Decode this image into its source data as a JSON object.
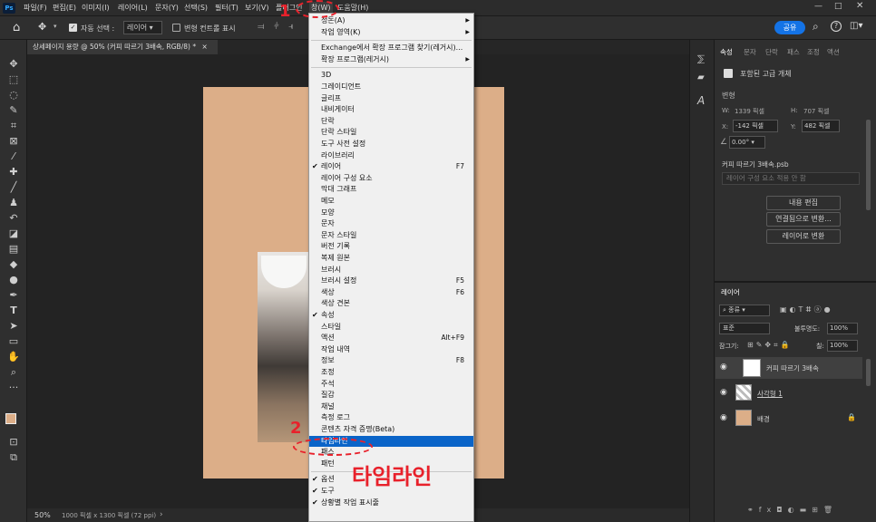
{
  "menubar": {
    "logo": "Ps",
    "items": [
      "파일(F)",
      "편집(E)",
      "이미지(I)",
      "레이어(L)",
      "문자(Y)",
      "선택(S)",
      "필터(T)",
      "보기(V)",
      "플러그인",
      "창(W)",
      "도움말(H)"
    ]
  },
  "options": {
    "auto_select_label": "자동 선택 :",
    "auto_select_value": "레이어",
    "transform_label": "변형 컨트롤 표시",
    "share_label": "공유"
  },
  "doc_tab": {
    "title": "상세페이지 용량 @ 50% (커피 따르기 3배속, RGB/8) *",
    "close": "×"
  },
  "status": {
    "zoom": "50%",
    "info": "1000 픽셀 x 1300 픽셀 (72 ppi)",
    "arrow": "›"
  },
  "window_menu": {
    "items": [
      {
        "label": "정돈(A)",
        "submenu": true
      },
      {
        "label": "작업 영역(K)",
        "submenu": true
      },
      {
        "sep": true
      },
      {
        "label": "Exchange에서 확장 프로그램 찾기(레거시)..."
      },
      {
        "label": "확장 프로그램(레거시)",
        "submenu": true
      },
      {
        "sep": true
      },
      {
        "label": "3D"
      },
      {
        "label": "그레이디언트"
      },
      {
        "label": "글리프"
      },
      {
        "label": "내비게이터"
      },
      {
        "label": "단락"
      },
      {
        "label": "단락 스타일"
      },
      {
        "label": "도구 사전 설정"
      },
      {
        "label": "라이브러리"
      },
      {
        "label": "레이어",
        "check": true,
        "shortcut": "F7"
      },
      {
        "label": "레이어 구성 요소"
      },
      {
        "label": "막대 그래프"
      },
      {
        "label": "메모"
      },
      {
        "label": "모양"
      },
      {
        "label": "문자"
      },
      {
        "label": "문자 스타일"
      },
      {
        "label": "버전 기록"
      },
      {
        "label": "복제 원본"
      },
      {
        "label": "브러시"
      },
      {
        "label": "브러시 설정",
        "shortcut": "F5"
      },
      {
        "label": "색상",
        "shortcut": "F6"
      },
      {
        "label": "색상 견본"
      },
      {
        "label": "속성",
        "check": true
      },
      {
        "label": "스타일"
      },
      {
        "label": "액션",
        "shortcut": "Alt+F9"
      },
      {
        "label": "작업 내역"
      },
      {
        "label": "정보",
        "shortcut": "F8"
      },
      {
        "label": "조정"
      },
      {
        "label": "주석"
      },
      {
        "label": "질감"
      },
      {
        "label": "채널"
      },
      {
        "label": "측정 로그"
      },
      {
        "label": "콘텐츠 자격 증명(Beta)"
      },
      {
        "label": "타임라인",
        "highlight": true
      },
      {
        "label": "패스"
      },
      {
        "label": "패턴"
      },
      {
        "sep": true
      },
      {
        "label": "옵션",
        "check": true
      },
      {
        "label": "도구",
        "check": true
      },
      {
        "label": "상황별 작업 표시줄",
        "check": true
      }
    ]
  },
  "annotations": {
    "step1": "1",
    "step2": "2",
    "callout": "타임라인"
  },
  "properties": {
    "tabs": [
      "속성",
      "문자",
      "단락",
      "패스",
      "조정",
      "액션"
    ],
    "type": "포함된 고급 개체",
    "transform_title": "변형",
    "w_label": "W:",
    "w_value": "1339 픽셀",
    "h_label": "H:",
    "h_value": "707 픽셀",
    "x_label": "X:",
    "x_value": "-142 픽셀",
    "y_label": "Y:",
    "y_value": "482 픽셀",
    "angle": "0.00°",
    "file": "커피 따르기 3배속.psb",
    "comp_placeholder": "레이어 구성 요소 적용 안 함",
    "btn_edit": "내용 편집",
    "btn_linked": "연결됨으로 변환...",
    "btn_layers": "레이어로 변환"
  },
  "layers": {
    "title": "레이어",
    "filter": "종류",
    "blend": "표준",
    "opacity_label": "불투명도:",
    "opacity": "100%",
    "lock_label": "잠그기:",
    "fill_label": "칠:",
    "fill": "100%",
    "items": [
      {
        "name": "커피 따르기 3배속"
      },
      {
        "name": "사각형 1"
      },
      {
        "name": "배경"
      }
    ]
  },
  "colors": {
    "accent": "#1473e6",
    "canvas": "#dcae88",
    "highlight": "#0a64c8",
    "annotation": "#e8212b"
  }
}
